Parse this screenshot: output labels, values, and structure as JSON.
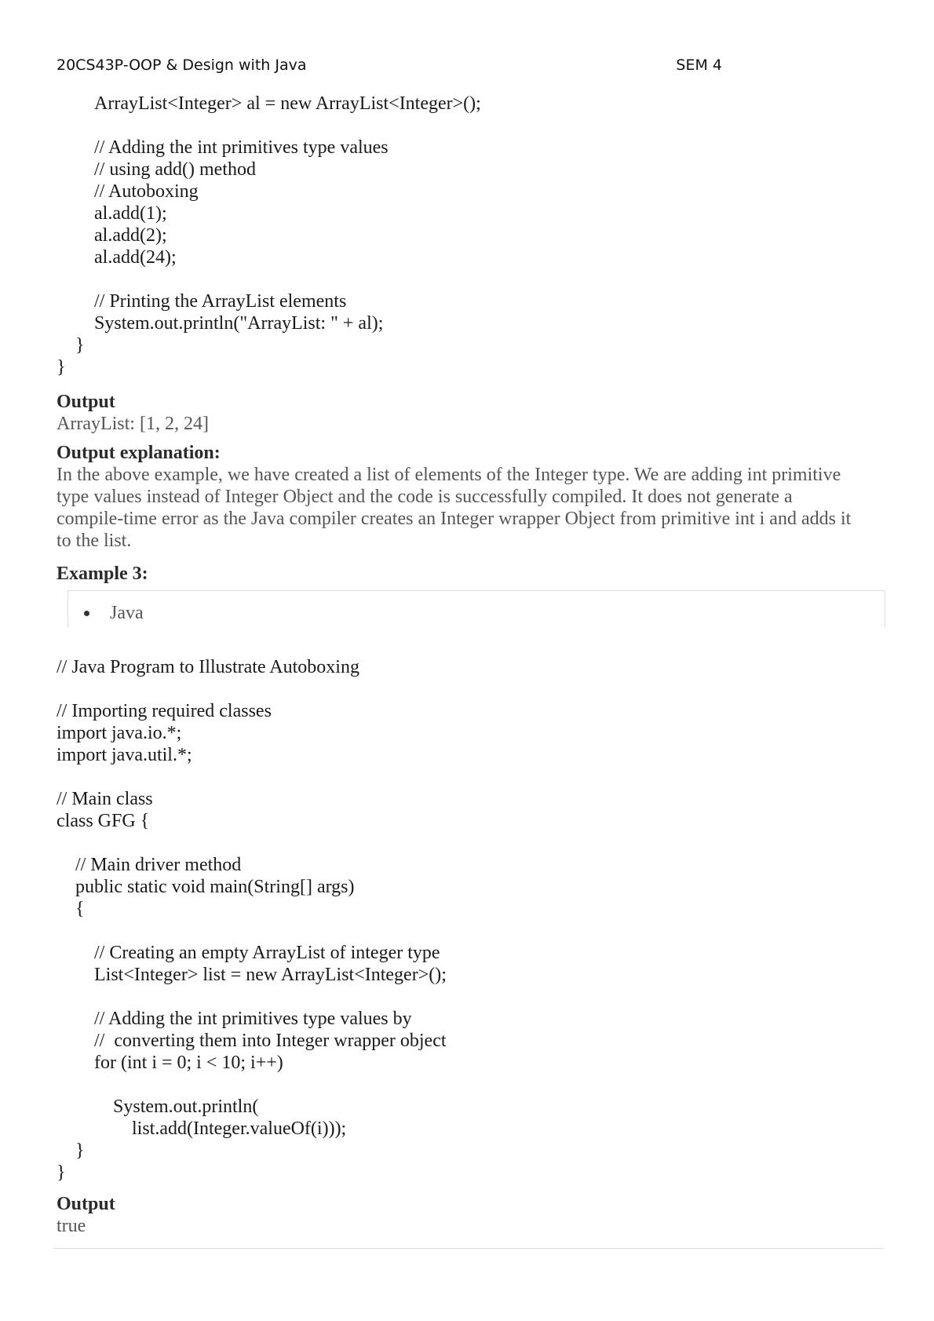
{
  "header": {
    "course": "20CS43P-OOP & Design with Java",
    "semester": "SEM 4"
  },
  "code_top": [
    {
      "indent": 2,
      "text": "ArrayList<Integer> al = new ArrayList<Integer>();"
    },
    {
      "indent": 2,
      "text": ""
    },
    {
      "indent": 2,
      "text": "// Adding the int primitives type values"
    },
    {
      "indent": 2,
      "text": "// using add() method"
    },
    {
      "indent": 2,
      "text": "// Autoboxing"
    },
    {
      "indent": 2,
      "text": "al.add(1);"
    },
    {
      "indent": 2,
      "text": "al.add(2);"
    },
    {
      "indent": 2,
      "text": "al.add(24);"
    },
    {
      "indent": 2,
      "text": ""
    },
    {
      "indent": 2,
      "text": "// Printing the ArrayList elements"
    },
    {
      "indent": 2,
      "text": "System.out.println(\"ArrayList: \" + al);"
    },
    {
      "indent": 1,
      "text": "}"
    },
    {
      "indent": 0,
      "text": "}"
    }
  ],
  "output1": {
    "heading": "Output",
    "value": "ArrayList: [1, 2, 24]"
  },
  "explanation": {
    "heading": "Output explanation:",
    "lines": [
      "In the above example, we have created a list of elements of the Integer type. We are adding int primitive",
      "type values instead of Integer Object and the code is successfully compiled. It does not generate a",
      "compile-time error as the Java compiler creates an Integer wrapper Object from primitive int i and adds it",
      "to the list."
    ]
  },
  "example3": {
    "heading": "Example 3:",
    "tab_label": "Java"
  },
  "code_bottom": [
    {
      "indent": 0,
      "text": "// Java Program to Illustrate Autoboxing"
    },
    {
      "indent": 0,
      "text": ""
    },
    {
      "indent": 0,
      "text": "// Importing required classes"
    },
    {
      "indent": 0,
      "text": "import java.io.*;"
    },
    {
      "indent": 0,
      "text": "import java.util.*;"
    },
    {
      "indent": 0,
      "text": ""
    },
    {
      "indent": 0,
      "text": "// Main class"
    },
    {
      "indent": 0,
      "text": "class GFG {"
    },
    {
      "indent": 0,
      "text": ""
    },
    {
      "indent": 1,
      "text": "// Main driver method"
    },
    {
      "indent": 1,
      "text": "public static void main(String[] args)"
    },
    {
      "indent": 1,
      "text": "{"
    },
    {
      "indent": 0,
      "text": ""
    },
    {
      "indent": 2,
      "text": "// Creating an empty ArrayList of integer type"
    },
    {
      "indent": 2,
      "text": "List<Integer> list = new ArrayList<Integer>();"
    },
    {
      "indent": 0,
      "text": ""
    },
    {
      "indent": 2,
      "text": "// Adding the int primitives type values by"
    },
    {
      "indent": 2,
      "text": "//  converting them into Integer wrapper object"
    },
    {
      "indent": 2,
      "text": "for (int i = 0; i < 10; i++)"
    },
    {
      "indent": 0,
      "text": ""
    },
    {
      "indent": 3,
      "text": "System.out.println("
    },
    {
      "indent": 4,
      "text": "list.add(Integer.valueOf(i)));"
    },
    {
      "indent": 1,
      "text": "}"
    },
    {
      "indent": 0,
      "text": "}"
    }
  ],
  "output2": {
    "heading": "Output",
    "value": "true"
  }
}
